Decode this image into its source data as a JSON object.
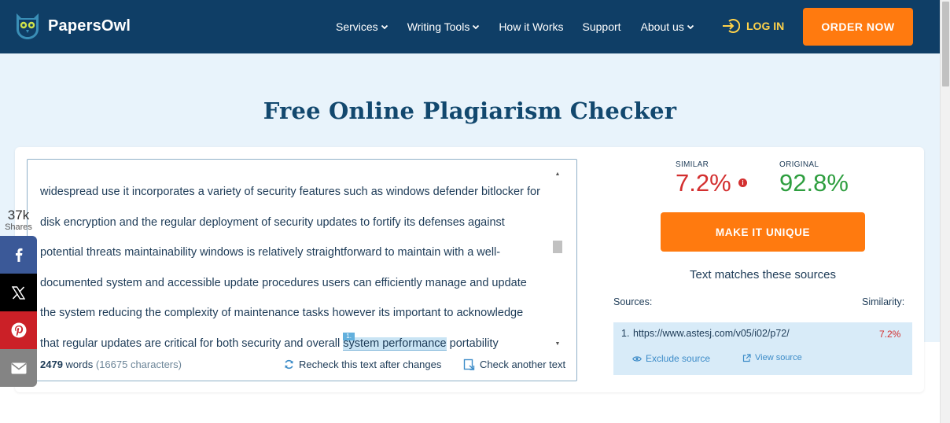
{
  "brand": {
    "name": "PapersOwl"
  },
  "nav": {
    "items": [
      {
        "label": "Services",
        "dropdown": true
      },
      {
        "label": "Writing Tools",
        "dropdown": true
      },
      {
        "label": "How it Works",
        "dropdown": false
      },
      {
        "label": "Support",
        "dropdown": false
      },
      {
        "label": "About us",
        "dropdown": true
      }
    ],
    "login_label": "LOG IN",
    "order_label": "ORDER NOW"
  },
  "page": {
    "title": "Free Online Plagiarism Checker"
  },
  "editor": {
    "lines": [
      "widespread use it incorporates a variety of security features such as windows defender bitlocker for",
      "disk encryption and the regular deployment of security updates to fortify its defenses against",
      "potential threats maintainability windows is relatively straightforward to maintain with a well-",
      "documented system and accessible update procedures users can efficiently manage and update",
      "the system reducing the complexity of maintenance tasks however its important to acknowledge"
    ],
    "last_line_before": "that regular updates are critical for both security and overall ",
    "highlight_text": "system performance",
    "highlight_tag": "1.",
    "last_line_after": " portability",
    "words": "2479",
    "words_label": "words",
    "characters": "(16675 characters)",
    "recheck_label": "Recheck this text after changes",
    "check_another_label": "Check another text"
  },
  "results": {
    "similar_label": "SIMILAR",
    "similar_value": "7.2%",
    "original_label": "ORIGINAL",
    "original_value": "92.8%",
    "make_unique_label": "MAKE IT UNIQUE",
    "matches_heading": "Text matches these sources",
    "sources_label": "Sources:",
    "similarity_label": "Similarity:",
    "sources": [
      {
        "number": "1.",
        "url": "https://www.astesj.com/v05/i02/p72/",
        "similarity": "7.2%",
        "exclude_label": "Exclude source",
        "view_label": "View source"
      }
    ]
  },
  "share": {
    "count": "37k",
    "count_label": "Shares",
    "networks": [
      "facebook",
      "x",
      "pinterest",
      "email"
    ]
  },
  "colors": {
    "header_bg": "#0f3e66",
    "accent_orange": "#ff7a0f",
    "similar_red": "#d32f2f",
    "original_green": "#2e9e3f",
    "login_yellow": "#ffd24a"
  }
}
